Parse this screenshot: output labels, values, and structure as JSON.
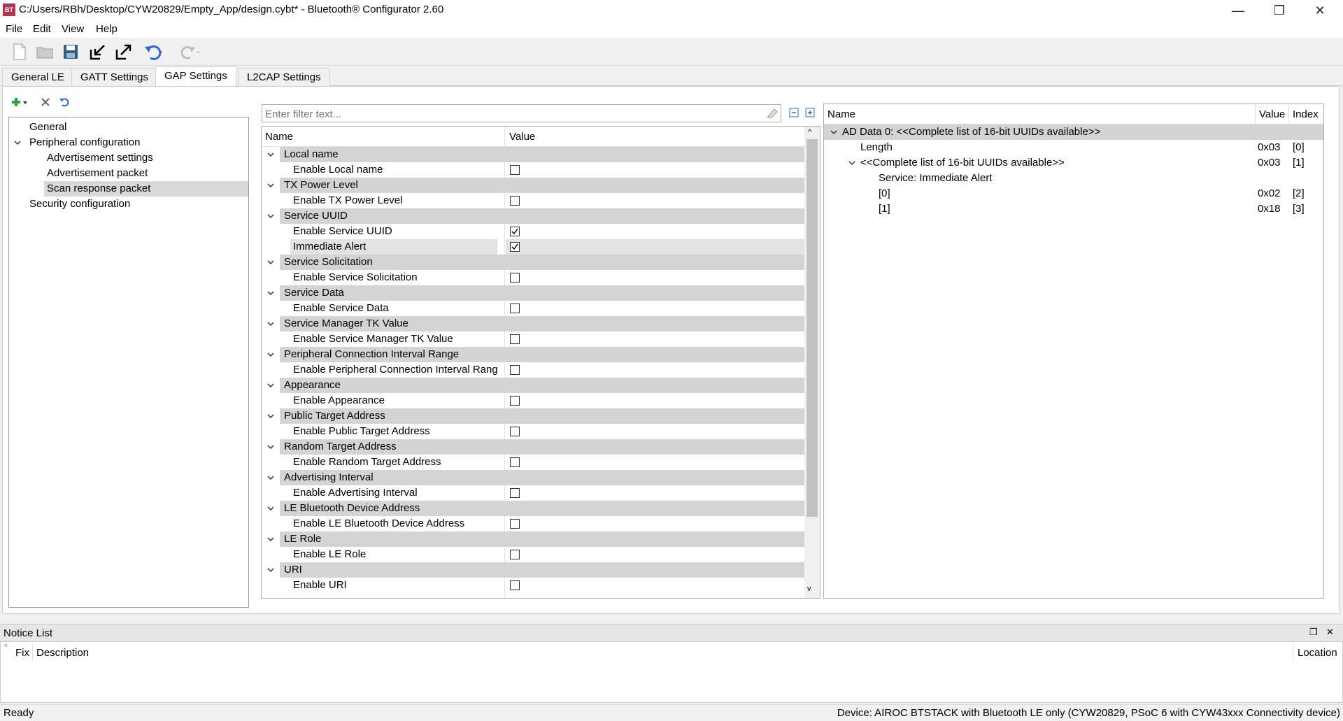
{
  "window": {
    "title": "C:/Users/RBh/Desktop/CYW20829/Empty_App/design.cybt* - Bluetooth® Configurator 2.60",
    "icon_text": "BT",
    "minimize_glyph": "—",
    "restore_glyph": "❐",
    "close_glyph": "✕"
  },
  "menu": [
    "File",
    "Edit",
    "View",
    "Help"
  ],
  "toolbar": {
    "icons": [
      "new-file-icon",
      "open-folder-icon",
      "save-icon",
      "import-icon",
      "export-icon",
      "undo-icon",
      "redo-icon"
    ]
  },
  "tabs": [
    {
      "label": "General LE",
      "active": false
    },
    {
      "label": "GATT Settings",
      "active": false
    },
    {
      "label": "GAP Settings",
      "active": true
    },
    {
      "label": "L2CAP Settings",
      "active": false
    }
  ],
  "left_tree": {
    "items": [
      {
        "label": "General",
        "level": 1,
        "expander": ""
      },
      {
        "label": "Peripheral configuration",
        "level": 1,
        "expander": "v"
      },
      {
        "label": "Advertisement settings",
        "level": 2,
        "expander": ""
      },
      {
        "label": "Advertisement packet",
        "level": 2,
        "expander": ""
      },
      {
        "label": "Scan response packet",
        "level": 2,
        "expander": "",
        "selected": true
      },
      {
        "label": "Security configuration",
        "level": 1,
        "expander": ""
      }
    ]
  },
  "filter": {
    "placeholder": "Enter filter text..."
  },
  "grid": {
    "col_name": "Name",
    "col_value": "Value",
    "groups": [
      {
        "name": "Local name",
        "items": [
          {
            "name": "Enable Local name",
            "checked": false
          }
        ]
      },
      {
        "name": "TX Power Level",
        "items": [
          {
            "name": "Enable TX Power Level",
            "checked": false
          }
        ]
      },
      {
        "name": "Service UUID",
        "items": [
          {
            "name": "Enable Service UUID",
            "checked": true
          },
          {
            "name": "Immediate Alert",
            "checked": true,
            "highlight": true
          }
        ]
      },
      {
        "name": "Service Solicitation",
        "items": [
          {
            "name": "Enable Service Solicitation",
            "checked": false
          }
        ]
      },
      {
        "name": "Service Data",
        "items": [
          {
            "name": "Enable Service Data",
            "checked": false
          }
        ]
      },
      {
        "name": "Service Manager TK Value",
        "items": [
          {
            "name": "Enable Service Manager TK Value",
            "checked": false
          }
        ]
      },
      {
        "name": "Peripheral Connection Interval Range",
        "items": [
          {
            "name": "Enable Peripheral Connection Interval Range",
            "checked": false
          }
        ]
      },
      {
        "name": "Appearance",
        "items": [
          {
            "name": "Enable Appearance",
            "checked": false
          }
        ]
      },
      {
        "name": "Public Target Address",
        "items": [
          {
            "name": "Enable Public Target Address",
            "checked": false
          }
        ]
      },
      {
        "name": "Random Target Address",
        "items": [
          {
            "name": "Enable Random Target Address",
            "checked": false
          }
        ]
      },
      {
        "name": "Advertising Interval",
        "items": [
          {
            "name": "Enable Advertising Interval",
            "checked": false
          }
        ]
      },
      {
        "name": "LE Bluetooth Device Address",
        "items": [
          {
            "name": "Enable LE Bluetooth Device Address",
            "checked": false
          }
        ]
      },
      {
        "name": "LE Role",
        "items": [
          {
            "name": "Enable LE Role",
            "checked": false
          }
        ]
      },
      {
        "name": "URI",
        "items": [
          {
            "name": "Enable URI",
            "checked": false
          }
        ]
      }
    ]
  },
  "right_panel": {
    "col_name": "Name",
    "col_value": "Value",
    "col_index": "Index",
    "rows": [
      {
        "name": "AD Data 0: <<Complete list of 16-bit UUIDs available>>",
        "value": "",
        "index": "",
        "indent": 0,
        "expander": "v",
        "selected": true
      },
      {
        "name": "Length",
        "value": "0x03",
        "index": "[0]",
        "indent": 1,
        "expander": ""
      },
      {
        "name": "<<Complete list of 16-bit UUIDs available>>",
        "value": "0x03",
        "index": "[1]",
        "indent": 1,
        "expander": "v"
      },
      {
        "name": "Service: Immediate Alert",
        "value": "",
        "index": "",
        "indent": 2,
        "expander": ""
      },
      {
        "name": "[0]",
        "value": "0x02",
        "index": "[2]",
        "indent": 2,
        "expander": ""
      },
      {
        "name": "[1]",
        "value": "0x18",
        "index": "[3]",
        "indent": 2,
        "expander": ""
      }
    ]
  },
  "notice_list": {
    "title": "Notice List",
    "col_fix": "Fix",
    "col_description": "Description",
    "col_location": "Location"
  },
  "status": {
    "left": "Ready",
    "right": "Device: AIROC BTSTACK with Bluetooth LE only (CYW20829, PSoC 6 with CYW43xxx Connectivity device)"
  }
}
